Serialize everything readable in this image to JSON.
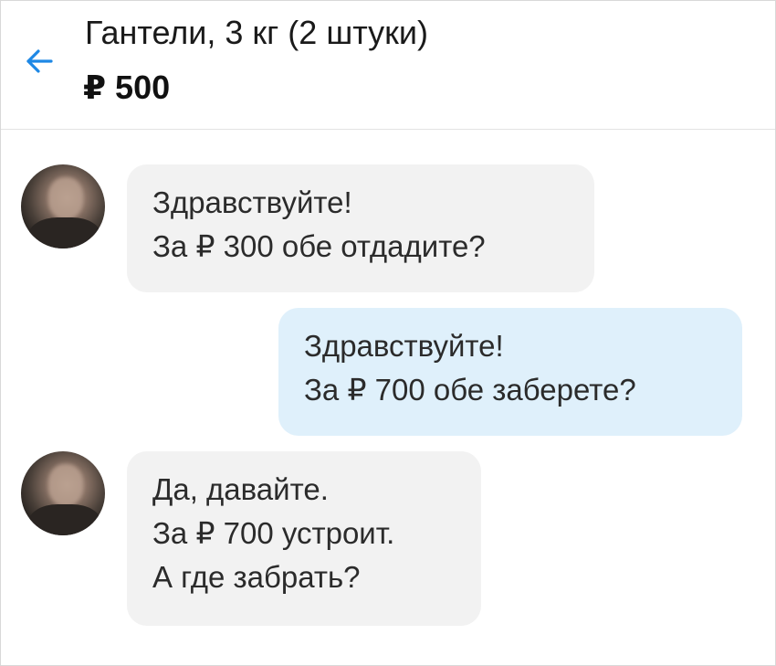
{
  "header": {
    "back_icon": "arrow-left-icon",
    "title": "Гантели, 3 кг (2 штуки)",
    "price": "₽ 500",
    "accent_color": "#1e88e5"
  },
  "messages": [
    {
      "direction": "incoming",
      "lines": [
        "Здравствуйте!",
        "За ₽ 300 обе отдадите?"
      ]
    },
    {
      "direction": "outgoing",
      "lines": [
        "Здравствуйте!",
        "За ₽ 700 обе заберете?"
      ]
    },
    {
      "direction": "incoming",
      "lines": [
        "Да, давайте.",
        "За ₽ 700 устроит.",
        "А где забрать?"
      ]
    }
  ],
  "colors": {
    "incoming_bubble": "#f2f2f2",
    "outgoing_bubble": "#dff0fb"
  }
}
